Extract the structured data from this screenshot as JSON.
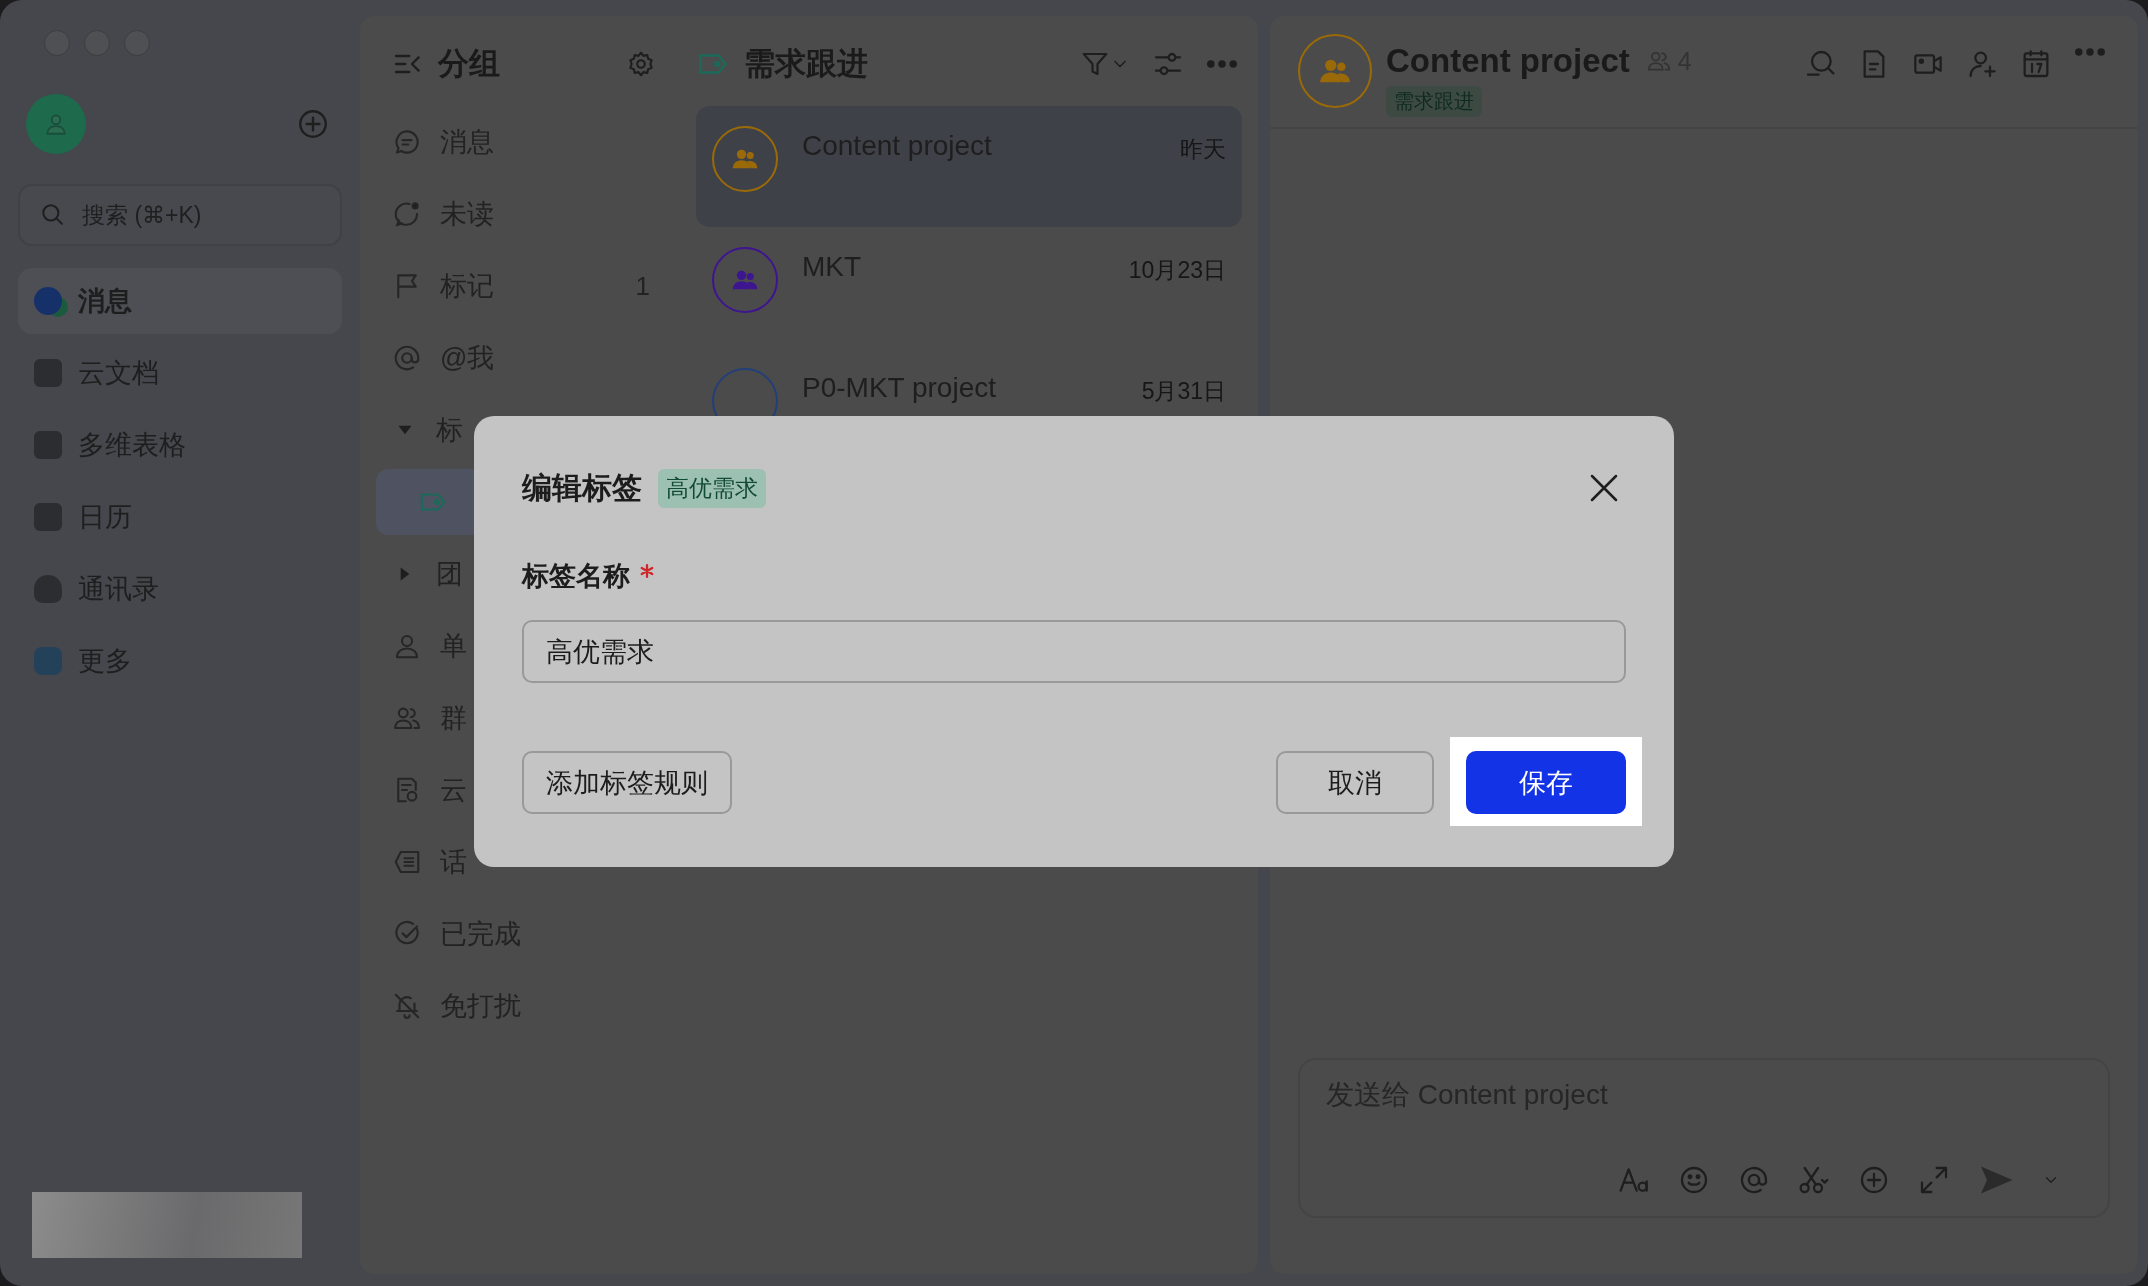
{
  "sidebar": {
    "search": {
      "placeholder": "搜索 (⌘+K)"
    },
    "nav": [
      {
        "label": "消息",
        "selected": true
      },
      {
        "label": "云文档",
        "selected": false
      },
      {
        "label": "多维表格",
        "selected": false
      },
      {
        "label": "日历",
        "selected": false
      },
      {
        "label": "通讯录",
        "selected": false
      },
      {
        "label": "更多",
        "selected": false
      }
    ]
  },
  "groups": {
    "title": "分组",
    "items": [
      {
        "kind": "item",
        "label": "消息",
        "selected": false
      },
      {
        "kind": "item",
        "label": "未读",
        "selected": false
      },
      {
        "kind": "item",
        "label": "标记",
        "count": "1",
        "selected": false
      },
      {
        "kind": "item",
        "label": "@我",
        "selected": false
      },
      {
        "kind": "folder",
        "label": "标",
        "expanded": true,
        "children": [
          {
            "kind": "tag",
            "selected": true
          }
        ]
      },
      {
        "kind": "folder",
        "label": "团",
        "expanded": false
      },
      {
        "kind": "item",
        "label": "单",
        "selected": false
      },
      {
        "kind": "item",
        "label": "群",
        "selected": false
      },
      {
        "kind": "item",
        "label": "云",
        "selected": false
      },
      {
        "kind": "item",
        "label": "话",
        "selected": false
      },
      {
        "kind": "item",
        "label": "已完成",
        "selected": false
      },
      {
        "kind": "item",
        "label": "免打扰",
        "selected": false
      }
    ]
  },
  "chat_list": {
    "title": "需求跟进",
    "chats": [
      {
        "name": "Content project",
        "time": "昨天",
        "selected": true,
        "color": "#9a6a08"
      },
      {
        "name": "MKT",
        "time": "10月23日",
        "selected": false,
        "color": "#3e1590"
      },
      {
        "name": "P0-MKT project",
        "time": "5月31日",
        "selected": false,
        "color": "#233f78"
      }
    ]
  },
  "chat": {
    "title": "Content project",
    "member_count": "4",
    "tag": "需求跟进",
    "composer": {
      "placeholder": "发送给 Content project"
    }
  },
  "dialog": {
    "title": "编辑标签",
    "tag": "高优需求",
    "field": {
      "label": "标签名称",
      "required": true,
      "value": "高优需求"
    },
    "buttons": [
      {
        "kind": "secondary",
        "label": "添加标签规则",
        "highlighted": false
      },
      {
        "kind": "secondary",
        "label": "取消",
        "highlighted": false
      },
      {
        "kind": "primary",
        "label": "保存",
        "highlighted": true
      }
    ]
  }
}
